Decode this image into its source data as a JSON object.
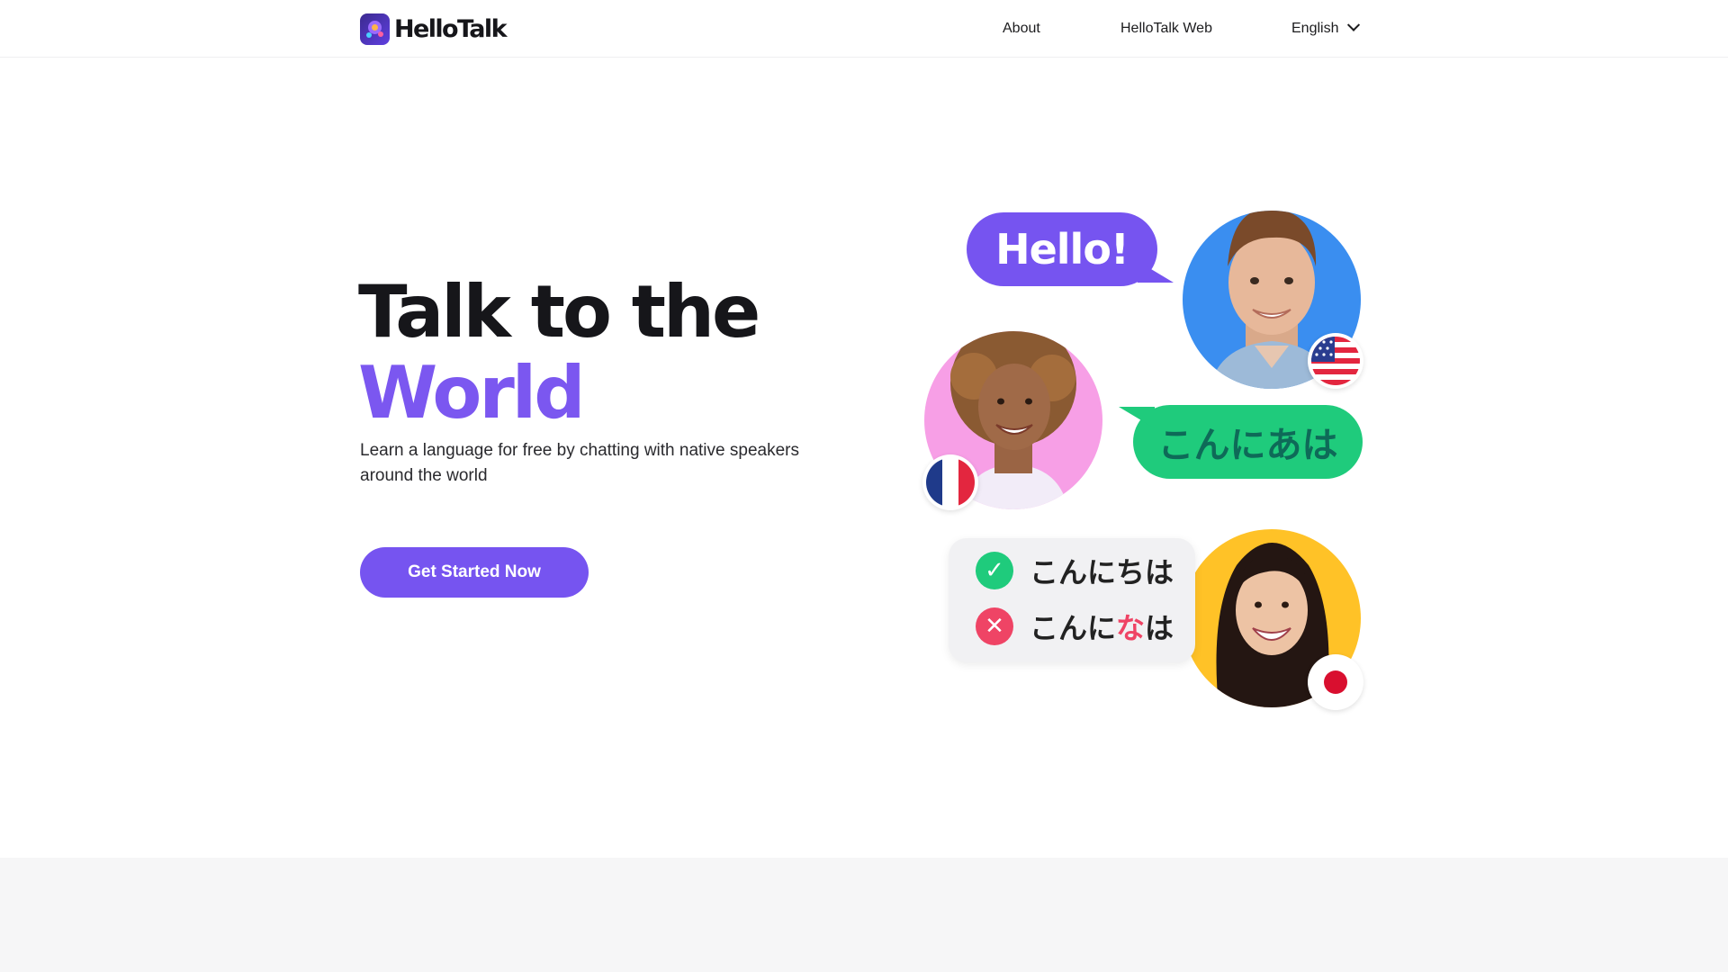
{
  "header": {
    "logo_text": "HelloTalk",
    "nav": {
      "about": "About",
      "web": "HelloTalk Web",
      "language": "English"
    }
  },
  "hero": {
    "title_line1": "Talk to the",
    "title_line2": "World",
    "subtitle": "Learn a language for free by chatting with native speakers around the world",
    "cta_label": "Get Started Now"
  },
  "illustration": {
    "bubble_hello": "Hello!",
    "bubble_japanese": "こんにあは",
    "quiz": {
      "correct_text": "こんにちは",
      "wrong_prefix": "こんに",
      "wrong_char": "な",
      "wrong_suffix": "は",
      "correct_icon": "check-icon",
      "wrong_icon": "x-icon"
    },
    "flags": [
      "us-flag-icon",
      "france-flag-icon",
      "japan-flag-icon"
    ]
  },
  "colors": {
    "accent": "#7654f0",
    "title_accent": "#7b57f0",
    "green": "#1fcb7c",
    "red": "#ef4465"
  }
}
